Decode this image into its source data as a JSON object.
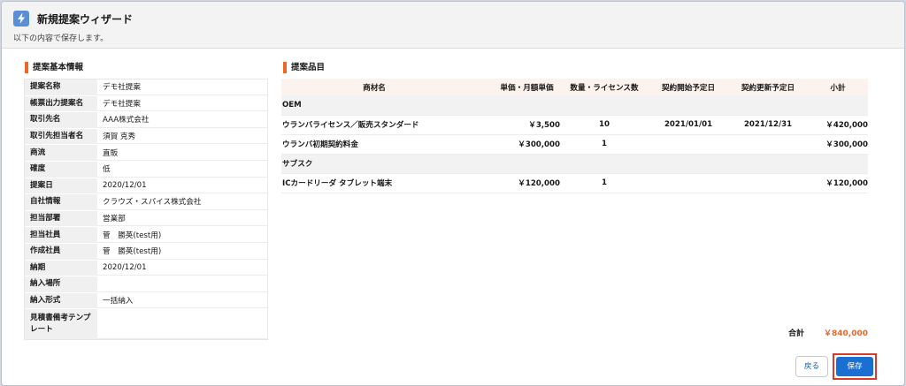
{
  "wizard": {
    "title": "新規提案ウィザード",
    "subtitle": "以下の内容で保存します。",
    "icon": "lightning-icon",
    "accent_color": "#e8682a"
  },
  "basic_info": {
    "section_title": "提案基本情報",
    "rows": [
      {
        "label": "提案名称",
        "value": "デモ社提案"
      },
      {
        "label": "帳票出力提案名",
        "value": "デモ社提案"
      },
      {
        "label": "取引先名",
        "value": "AAA株式会社"
      },
      {
        "label": "取引先担当者名",
        "value": "須賀 克秀"
      },
      {
        "label": "商流",
        "value": "直販"
      },
      {
        "label": "確度",
        "value": "低"
      },
      {
        "label": "提案日",
        "value": "2020/12/01"
      },
      {
        "label": "自社情報",
        "value": "クラウズ・スパイス株式会社"
      },
      {
        "label": "担当部署",
        "value": "営業部"
      },
      {
        "label": "担当社員",
        "value": "菅　勝英(test用)"
      },
      {
        "label": "作成社員",
        "value": "菅　勝英(test用)"
      },
      {
        "label": "納期",
        "value": "2020/12/01"
      },
      {
        "label": "納入場所",
        "value": ""
      },
      {
        "label": "納入形式",
        "value": "一括納入"
      },
      {
        "label": "見積書備考テンプレート",
        "value": ""
      }
    ]
  },
  "items": {
    "section_title": "提案品目",
    "columns": [
      "商材名",
      "単価・月額単価",
      "数量・ライセンス数",
      "契約開始予定日",
      "契約更新予定日",
      "小計"
    ],
    "groups": [
      {
        "name": "OEM",
        "rows": [
          {
            "name": "ウランバライセンス／販売スタンダード",
            "price": "￥3,500",
            "qty": "10",
            "start": "2021/01/01",
            "renew": "2021/12/31",
            "subtotal": "￥420,000"
          },
          {
            "name": "ウランバ初期契約料金",
            "price": "￥300,000",
            "qty": "1",
            "start": "",
            "renew": "",
            "subtotal": "￥300,000"
          }
        ]
      },
      {
        "name": "サブスク",
        "rows": [
          {
            "name": "ICカードリーダ タブレット端末",
            "price": "￥120,000",
            "qty": "1",
            "start": "",
            "renew": "",
            "subtotal": "￥120,000"
          }
        ]
      }
    ],
    "total_label": "合計",
    "total_value": "￥840,000"
  },
  "buttons": {
    "back_label": "戻る",
    "save_label": "保存"
  }
}
